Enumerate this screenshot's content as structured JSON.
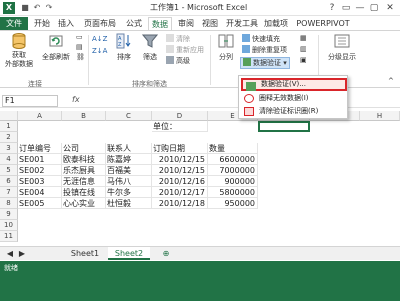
{
  "titlebar": {
    "app_logo": "X",
    "title": "工作簿1 - Microsoft Excel",
    "qat_icons": [
      "save-icon",
      "undo-icon",
      "redo-icon"
    ],
    "controls": [
      "?",
      "▭",
      "—",
      "▢",
      "✕"
    ]
  },
  "tabs": [
    {
      "label": "文件"
    },
    {
      "label": "开始"
    },
    {
      "label": "插入"
    },
    {
      "label": "页面布局"
    },
    {
      "label": "公式"
    },
    {
      "label": "数据"
    },
    {
      "label": "审阅"
    },
    {
      "label": "视图"
    },
    {
      "label": "开发工具"
    },
    {
      "label": "加载项"
    },
    {
      "label": "POWERPIVOT"
    }
  ],
  "ribbon": {
    "get_external": "获取\n外部数据",
    "refresh_all": "全部刷新",
    "connections_group": "连接",
    "sort_az": "A↓Z",
    "sort": "排序",
    "filter": "筛选",
    "clear": "清除",
    "reapply": "重新应用",
    "advanced": "高级",
    "sort_filter_group": "排序和筛选",
    "text_to_columns": "分列",
    "flash_fill": "快速填充",
    "remove_duplicates": "删除重复项",
    "data_validation": "数据验证",
    "outline": "分级显示"
  },
  "dropdown": {
    "items": [
      {
        "label": "数据验证(V)..."
      },
      {
        "label": "圈释无效数据(I)"
      },
      {
        "label": "清除验证标识圈(R)"
      }
    ]
  },
  "formula_bar": {
    "namebox": "F1",
    "fx": "fx"
  },
  "columns": [
    "A",
    "B",
    "C",
    "D",
    "E",
    "F",
    "G",
    "H"
  ],
  "rows": [
    "1",
    "2",
    "3",
    "4",
    "5",
    "6",
    "7",
    "8",
    "9",
    "10",
    "11"
  ],
  "sheet": {
    "d1": "单位：",
    "headers": [
      "订单编号",
      "公司",
      "联系人",
      "订购日期",
      "数量"
    ],
    "records": [
      [
        "SE001",
        "欧泰科技",
        "陈嘉婷",
        "2010/12/15",
        "6600000"
      ],
      [
        "SE002",
        "乐杰厨具",
        "百福美",
        "2010/12/15",
        "7000000"
      ],
      [
        "SE003",
        "无涯信息",
        "马伟八",
        "2010/12/16",
        "900000"
      ],
      [
        "SE004",
        "投镇在线",
        "牛尔多",
        "2010/12/17",
        "5800000"
      ],
      [
        "SE005",
        "心心实业",
        "杜恒毅",
        "2010/12/18",
        "950000"
      ]
    ]
  },
  "sheet_tabs": [
    {
      "label": "Sheet1"
    },
    {
      "label": "Sheet2"
    }
  ],
  "add_sheet": "⊕",
  "status": "就绪"
}
